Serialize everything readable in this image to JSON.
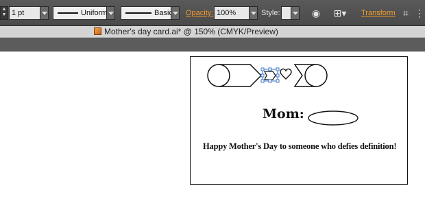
{
  "control_bar": {
    "stroke_weight": "1 pt",
    "stroke_profile": "Uniform",
    "brush_definition": "Basic",
    "opacity_label": "Opacity:",
    "opacity_value": "100%",
    "style_label": "Style:",
    "transform_label": "Transform",
    "icons": [
      "weight-spinner-icon",
      "recolor-artwork-icon",
      "align-icon",
      "transform-panel-icon",
      "more-icon"
    ]
  },
  "document": {
    "tab_title": "Mother's day card.ai* @ 150% (CMYK/Preview)",
    "file_icon": "illustrator-file-icon"
  },
  "artboard": {
    "heading": "Mom:",
    "tagline": "Happy Mother's Day to someone who defies definition!"
  },
  "colors": {
    "link_orange": "#f39c2a",
    "toolbar_dark": "#4a4a4a",
    "selection_blue": "#3d74c9"
  }
}
